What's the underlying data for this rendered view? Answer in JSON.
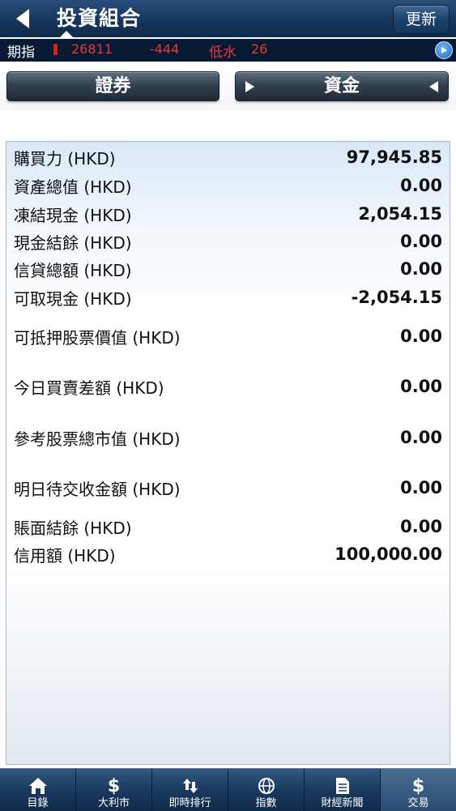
{
  "header": {
    "title": "投資組合",
    "refresh_label": "更新"
  },
  "ticker": {
    "label": "期指",
    "value": "26811",
    "change": "-444",
    "basis_label": "低水",
    "basis_value": "26"
  },
  "segments": {
    "left_label": "證券",
    "right_label": "資金",
    "selected": "資金"
  },
  "account": {
    "rows": [
      {
        "label": "購買力 (HKD)",
        "value": "97,945.85"
      },
      {
        "label": "資產總值 (HKD)",
        "value": "0.00"
      },
      {
        "label": "凍結現金 (HKD)",
        "value": "2,054.15"
      },
      {
        "label": "現金結餘 (HKD)",
        "value": "0.00"
      },
      {
        "label": "信貸總額 (HKD)",
        "value": "0.00"
      },
      {
        "label": "可取現金 (HKD)",
        "value": "-2,054.15"
      },
      {
        "label": "可抵押股票價值 (HKD)",
        "value": "0.00"
      },
      {
        "label": "今日買賣差額 (HKD)",
        "value": "0.00"
      },
      {
        "label": "參考股票總市值 (HKD)",
        "value": "0.00"
      },
      {
        "label": "明日待交收金額 (HKD)",
        "value": "0.00"
      },
      {
        "label": "賬面結餘 (HKD)",
        "value": "0.00"
      },
      {
        "label": "信用額 (HKD)",
        "value": "100,000.00"
      }
    ]
  },
  "tabbar": {
    "items": [
      {
        "label": "目錄",
        "icon": "home-icon"
      },
      {
        "label": "大利市",
        "icon": "dollar-icon"
      },
      {
        "label": "即時排行",
        "icon": "up-down-arrows-icon"
      },
      {
        "label": "指數",
        "icon": "globe-icon"
      },
      {
        "label": "財經新聞",
        "icon": "document-icon"
      },
      {
        "label": "交易",
        "icon": "dollar-icon"
      }
    ],
    "active": "交易"
  },
  "colors": {
    "header_bg": "#16365c",
    "ticker_bg": "#081a33",
    "ticker_red": "#e23a3a",
    "tabbar_bg": "#1b3a60"
  }
}
